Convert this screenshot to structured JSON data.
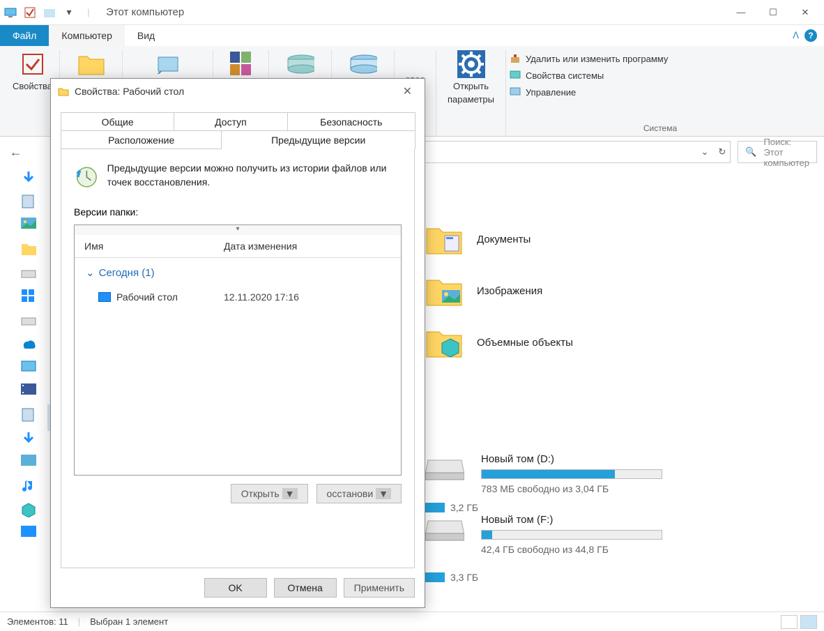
{
  "window": {
    "title": "Этот компьютер"
  },
  "tabs": {
    "file": "Файл",
    "computer": "Компьютер",
    "view": "Вид"
  },
  "ribbon": {
    "properties": "Свойства",
    "open_settings_l1": "Открыть",
    "open_settings_l2": "параметры",
    "link_uninstall": "Удалить или изменить программу",
    "link_sysprops": "Свойства системы",
    "link_manage": "Управление",
    "group_system": "Система"
  },
  "search": {
    "placeholder": "Поиск: Этот компьютер"
  },
  "folders": {
    "documents": "Документы",
    "pictures": "Изображения",
    "objects3d": "Объемные объекты"
  },
  "drives": {
    "d": {
      "name": "Новый том (D:)",
      "sub": "783 МБ свободно из 3,04 ГБ",
      "fill": 74
    },
    "c_sub": "3,2 ГБ",
    "e_sub": "3,3 ГБ",
    "f": {
      "name": "Новый том (F:)",
      "sub": "42,4 ГБ свободно из 44,8 ГБ",
      "fill": 6
    }
  },
  "status": {
    "elements": "Элементов: 11",
    "selected": "Выбран 1 элемент"
  },
  "dialog": {
    "title": "Свойства: Рабочий стол",
    "tabs": {
      "general": "Общие",
      "sharing": "Доступ",
      "security": "Безопасность",
      "location": "Расположение",
      "previous": "Предыдущие версии"
    },
    "desc": "Предыдущие версии можно получить из истории файлов или точек восстановления.",
    "versions_label": "Версии папки:",
    "col_name": "Имя",
    "col_date": "Дата изменения",
    "group": "Сегодня (1)",
    "row_name": "Рабочий стол",
    "row_date": "12.11.2020 17:16",
    "btn_open": "Открыть",
    "btn_restore": "осстанови",
    "btn_ok": "OK",
    "btn_cancel": "Отмена",
    "btn_apply": "Применить"
  }
}
